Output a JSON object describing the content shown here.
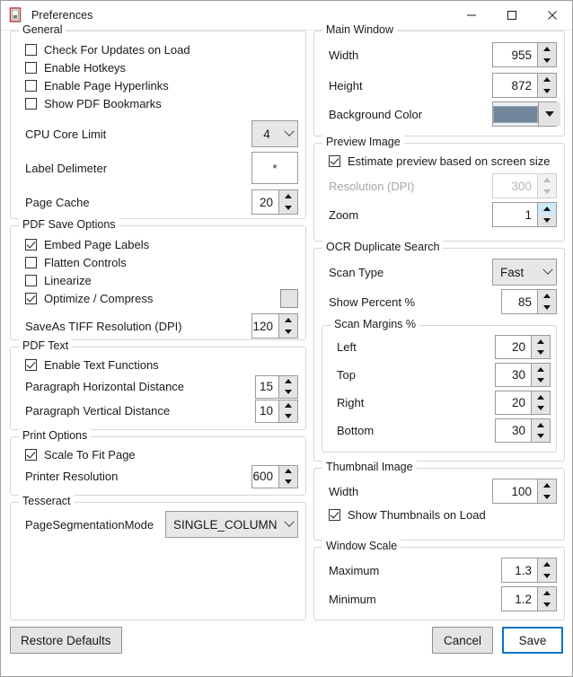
{
  "window": {
    "title": "Preferences",
    "icon": "document-icon",
    "controls": {
      "minimize": "minimize-icon",
      "maximize": "maximize-icon",
      "close": "close-icon"
    }
  },
  "colors": {
    "background_color_swatch": "#71869b",
    "accent": "#0a72c4",
    "spin_hot": "#cde8f8"
  },
  "general": {
    "legend": "General",
    "checkboxes": [
      {
        "label": "Check For Updates on Load",
        "checked": false
      },
      {
        "label": "Enable Hotkeys",
        "checked": false
      },
      {
        "label": "Enable Page Hyperlinks",
        "checked": false
      },
      {
        "label": "Show PDF Bookmarks",
        "checked": false
      }
    ],
    "cpu_core_limit": {
      "label": "CPU Core Limit",
      "value": "4"
    },
    "label_delimeter": {
      "label": "Label Delimeter",
      "value": "*"
    },
    "page_cache": {
      "label": "Page Cache",
      "value": "20"
    }
  },
  "pdf_save_options": {
    "legend": "PDF Save Options",
    "checkboxes": [
      {
        "label": "Embed Page Labels",
        "checked": true
      },
      {
        "label": "Flatten Controls",
        "checked": false
      },
      {
        "label": "Linearize",
        "checked": false
      },
      {
        "label": "Optimize / Compress",
        "checked": true
      }
    ],
    "tiff_resolution": {
      "label": "SaveAs TIFF Resolution (DPI)",
      "value": "120"
    }
  },
  "pdf_text": {
    "legend": "PDF Text",
    "enable_text_functions": {
      "label": "Enable Text Functions",
      "checked": true
    },
    "paragraph_horizontal": {
      "label": "Paragraph Horizontal Distance",
      "value": "15"
    },
    "paragraph_vertical": {
      "label": "Paragraph Vertical Distance",
      "value": "10"
    }
  },
  "print_options": {
    "legend": "Print Options",
    "scale_to_fit": {
      "label": "Scale To Fit Page",
      "checked": true
    },
    "printer_resolution": {
      "label": "Printer Resolution",
      "value": "600"
    }
  },
  "tesseract": {
    "legend": "Tesseract",
    "page_segmentation_mode": {
      "label": "PageSegmentationMode",
      "value": "SINGLE_COLUMN"
    }
  },
  "main_window": {
    "legend": "Main Window",
    "width": {
      "label": "Width",
      "value": "955"
    },
    "height": {
      "label": "Height",
      "value": "872"
    },
    "background_color": {
      "label": "Background Color"
    }
  },
  "preview_image": {
    "legend": "Preview Image",
    "estimate_preview": {
      "label": "Estimate preview based on screen size",
      "checked": true
    },
    "resolution": {
      "label": "Resolution (DPI)",
      "value": "300",
      "disabled": true
    },
    "zoom": {
      "label": "Zoom",
      "value": "1"
    }
  },
  "ocr_duplicate_search": {
    "legend": "OCR Duplicate Search",
    "scan_type": {
      "label": "Scan Type",
      "value": "Fast"
    },
    "show_percent": {
      "label": "Show Percent %",
      "value": "85"
    },
    "scan_margins": {
      "legend": "Scan Margins %",
      "left": {
        "label": "Left",
        "value": "20"
      },
      "top": {
        "label": "Top",
        "value": "30"
      },
      "right": {
        "label": "Right",
        "value": "20"
      },
      "bottom": {
        "label": "Bottom",
        "value": "30"
      }
    }
  },
  "thumbnail_image": {
    "legend": "Thumbnail Image",
    "width": {
      "label": "Width",
      "value": "100"
    },
    "show_thumbnails": {
      "label": "Show Thumbnails on Load",
      "checked": true
    }
  },
  "window_scale": {
    "legend": "Window Scale",
    "maximum": {
      "label": "Maximum",
      "value": "1.3"
    },
    "minimum": {
      "label": "Minimum",
      "value": "1.2"
    }
  },
  "footer": {
    "restore_defaults": "Restore Defaults",
    "cancel": "Cancel",
    "save": "Save"
  }
}
